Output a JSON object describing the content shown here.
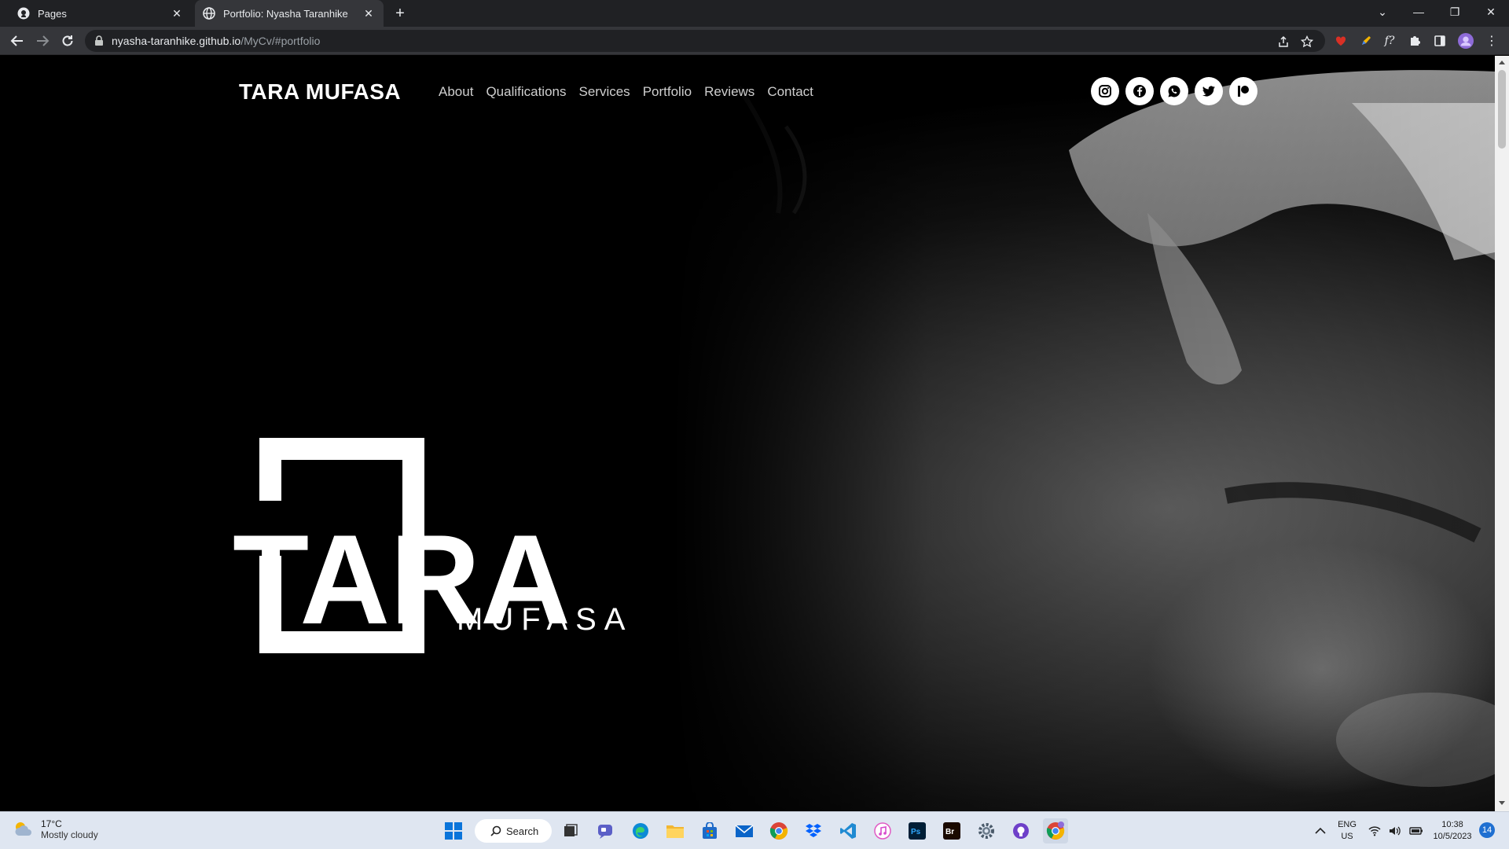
{
  "browser": {
    "tabs": [
      {
        "title": "Pages",
        "favicon": "github-icon",
        "active": false
      },
      {
        "title": "Portfolio: Nyasha Taranhike",
        "favicon": "globe-icon",
        "active": true
      }
    ],
    "url_host": "nyasha-taranhike.github.io",
    "url_path": "/MyCv/#portfolio"
  },
  "site": {
    "logo_text": "TARA MUFASA",
    "nav": [
      "About",
      "Qualifications",
      "Services",
      "Portfolio",
      "Reviews",
      "Contact"
    ],
    "socials": [
      "instagram-icon",
      "facebook-icon",
      "whatsapp-icon",
      "twitter-icon",
      "patreon-icon"
    ],
    "hero": {
      "word1": "TARA",
      "word2": "MUFASA"
    }
  },
  "taskbar": {
    "weather_temp": "17°C",
    "weather_desc": "Mostly cloudy",
    "search_label": "Search",
    "lang": "ENG",
    "region": "US",
    "time": "10:38",
    "date": "10/5/2023",
    "notification_count": "14"
  },
  "colors": {
    "accent_blue": "#1f6fd1",
    "page_bg": "#000000",
    "chrome_dark": "#202124"
  }
}
